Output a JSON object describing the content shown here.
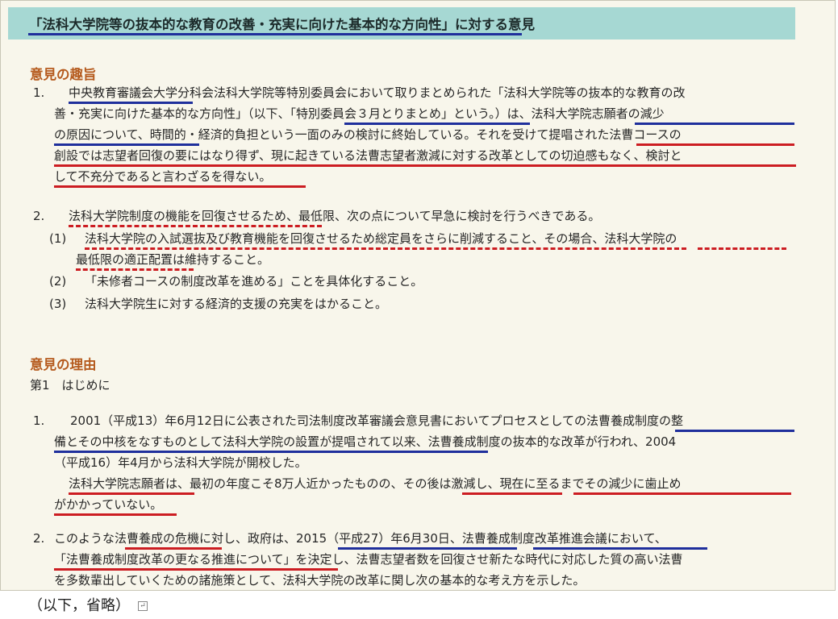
{
  "title": "「法科大学院等の抜本的な教育の改善・充実に向けた基本的な方向性」に対する意見",
  "summary": {
    "heading": "意見の趣旨",
    "item1": {
      "num": "1.",
      "lines": [
        "中央教育審議会大学分科会法科大学院等特別委員会において取りまとめられた「法科大学院等の抜本的な教育の改",
        "善・充実に向けた基本的な方向性」（以下、「特別委員会３月とりまとめ」という。）は、法科大学院志願者の減少",
        "の原因について、時間的・経済的負担という一面のみの検討に終始している。それを受けて提唱された法曹コースの",
        "創設では志望者回復の要にはなり得ず、現に起きている法曹志望者激減に対する改革としての切迫感もなく、検討と",
        "して不充分であると言わざるを得ない。"
      ]
    },
    "item2": {
      "num": "2.",
      "line": "法科大学院制度の機能を回復させるため、最低限、次の点について早急に検討を行うべきである。",
      "subitems": [
        {
          "num": "(1)",
          "lines": [
            "法科大学院の入試選抜及び教育機能を回復させるため総定員をさらに削減すること、その場合、法科大学院の",
            "最低限の適正配置は維持すること。"
          ]
        },
        {
          "num": "(2)",
          "lines": [
            "「未修者コースの制度改革を進める」ことを具体化すること。"
          ]
        },
        {
          "num": "(3)",
          "lines": [
            "法科大学院生に対する経済的支援の充実をはかること。"
          ]
        }
      ]
    }
  },
  "reasons": {
    "heading": "意見の理由",
    "subheading": "第1　はじめに",
    "item1": {
      "num": "1.",
      "lines": [
        "2001（平成13）年6月12日に公表された司法制度改革審議会意見書においてプロセスとしての法曹養成制度の整",
        "備とその中核をなすものとして法科大学院の設置が提唱されて以来、法曹養成制度の抜本的な改革が行われ、2004",
        "（平成16）年4月から法科大学院が開校した。",
        "法科大学院志願者は、最初の年度こそ8万人近かったものの、その後は激減し、現在に至るまでその減少に歯止め",
        "がかかっていない。"
      ]
    },
    "item2": {
      "num": "2.",
      "lines": [
        "このような法曹養成の危機に対し、政府は、2015（平成27）年6月30日、法曹養成制度改革推進会議において、",
        "「法曹養成制度改革の更なる推進について」を決定し、法曹志望者数を回復させ新たな時代に対応した質の高い法曹",
        "を多数輩出していくための諸施策として、法科大学院の改革に関し次の基本的な考え方を示した。"
      ]
    }
  },
  "footer": {
    "text": "（以下，省略）",
    "icon": "return-mark-icon"
  }
}
